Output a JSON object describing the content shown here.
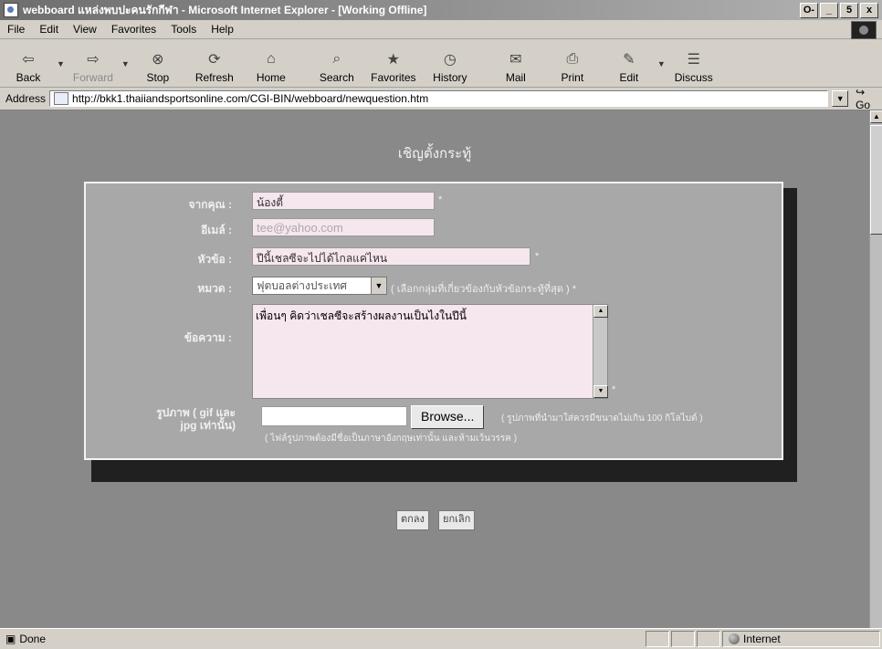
{
  "window": {
    "title": "webboard แหล่งพบปะคนรักกีฬา - Microsoft Internet Explorer - [Working Offline]",
    "controls": [
      "O-",
      "_",
      "5",
      "x"
    ]
  },
  "menu": [
    "File",
    "Edit",
    "View",
    "Favorites",
    "Tools",
    "Help"
  ],
  "toolbar": [
    {
      "label": "Back",
      "icon": "back-arrow-icon",
      "glyph": "⇦",
      "enabled": true
    },
    {
      "label": "Forward",
      "icon": "forward-arrow-icon",
      "glyph": "⇨",
      "enabled": false
    },
    {
      "label": "Stop",
      "icon": "stop-icon",
      "glyph": "⊗",
      "enabled": true
    },
    {
      "label": "Refresh",
      "icon": "refresh-icon",
      "glyph": "⟳",
      "enabled": true
    },
    {
      "label": "Home",
      "icon": "home-icon",
      "glyph": "⌂",
      "enabled": true
    },
    {
      "label": "Search",
      "icon": "search-icon",
      "glyph": "⌕",
      "enabled": true
    },
    {
      "label": "Favorites",
      "icon": "favorites-icon",
      "glyph": "★",
      "enabled": true
    },
    {
      "label": "History",
      "icon": "history-icon",
      "glyph": "◷",
      "enabled": true
    },
    {
      "label": "Mail",
      "icon": "mail-icon",
      "glyph": "✉",
      "enabled": true
    },
    {
      "label": "Print",
      "icon": "print-icon",
      "glyph": "⎙",
      "enabled": true
    },
    {
      "label": "Edit",
      "icon": "edit-icon",
      "glyph": "✎",
      "enabled": true
    },
    {
      "label": "Discuss",
      "icon": "discuss-icon",
      "glyph": "☰",
      "enabled": true
    }
  ],
  "address": {
    "label": "Address",
    "url": "http://bkk1.thaiiandsportsonline.com/CGI-BIN/webboard/newquestion.htm",
    "go": "Go"
  },
  "page": {
    "heading": "เชิญตั้งกระทู้",
    "form": {
      "name_label": "จากคุณ :",
      "name_value": "น้องตี้",
      "email_label": "อีเมล์ :",
      "email_value": "tee@yahoo.com",
      "subject_label": "หัวข้อ :",
      "subject_value": "ปีนี้เชลซีจะไปได้ไกลแค่ไหน",
      "category_label": "หมวด :",
      "category_value": "ฟุตบอลต่างประเทศ",
      "category_hint": "( เลือกกลุ่มที่เกี่ยวข้องกับหัวข้อกระทู้ที่สุด ) *",
      "message_label": "ข้อความ :",
      "message_value": "เพื่อนๆ คิดว่าเชลซีจะสร้างผลงานเป็นไงในปีนี้",
      "image_label": "รูปภาพ ( gif และ jpg เท่านั้น)",
      "browse_label": "Browse...",
      "image_hint_1": "( รูปภาพที่นำมาใส่ควรมีขนาดไม่เกิน 100 กิโลไบต์ )",
      "image_hint_2": "( ไฟล์รูปภาพต้องมีชื่อเป็นภาษาอังกฤษเท่านั้น และห้ามเว้นวรรค )",
      "required_mark": "*"
    },
    "submit_label": "ตกลง",
    "cancel_label": "ยกเลิก"
  },
  "status": {
    "text": "Done",
    "zone": "Internet"
  },
  "colors": {
    "page_bg": "#898989",
    "form_bg": "#a8a8a8",
    "input_pink": "#f6e6ee"
  }
}
